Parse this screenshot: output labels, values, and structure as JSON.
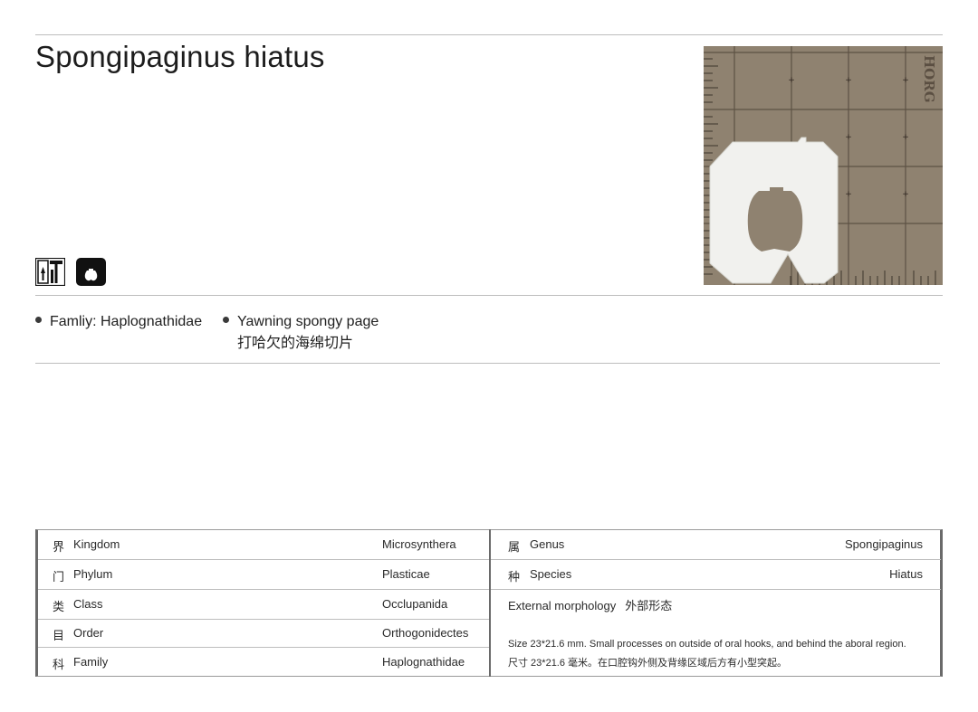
{
  "title": "Spongipaginus hiatus",
  "icons": {
    "first": "hand-tools-icon",
    "second": "yawning-page-icon"
  },
  "specimen_image": {
    "label_text": "HORG",
    "background_color": "#8f8270"
  },
  "bullets": {
    "family": "Famliy: Haplognathidae",
    "common_name_en": "Yawning spongy page",
    "common_name_cn": "打哈欠的海绵切片"
  },
  "taxonomy": {
    "left": [
      {
        "cn": "界",
        "rank": "Kingdom",
        "value": "Microsynthera"
      },
      {
        "cn": "门",
        "rank": "Phylum",
        "value": "Plasticae"
      },
      {
        "cn": "类",
        "rank": "Class",
        "value": "Occlupanida"
      },
      {
        "cn": "目",
        "rank": "Order",
        "value": "Orthogonidectes"
      },
      {
        "cn": "科",
        "rank": "Family",
        "value": "Haplognathidae"
      }
    ],
    "right": [
      {
        "cn": "属",
        "rank": "Genus",
        "value": "Spongipaginus"
      },
      {
        "cn": "种",
        "rank": "Species",
        "value": "Hiatus"
      }
    ],
    "morphology": {
      "label_en": "External morphology",
      "label_cn": "外部形态",
      "text_en": "Size 23*21.6 mm. Small processes on outside of oral hooks, and behind the aboral region.",
      "text_cn": "尺寸 23*21.6 毫米。在口腔钩外侧及背缘区域后方有小型突起。"
    }
  }
}
